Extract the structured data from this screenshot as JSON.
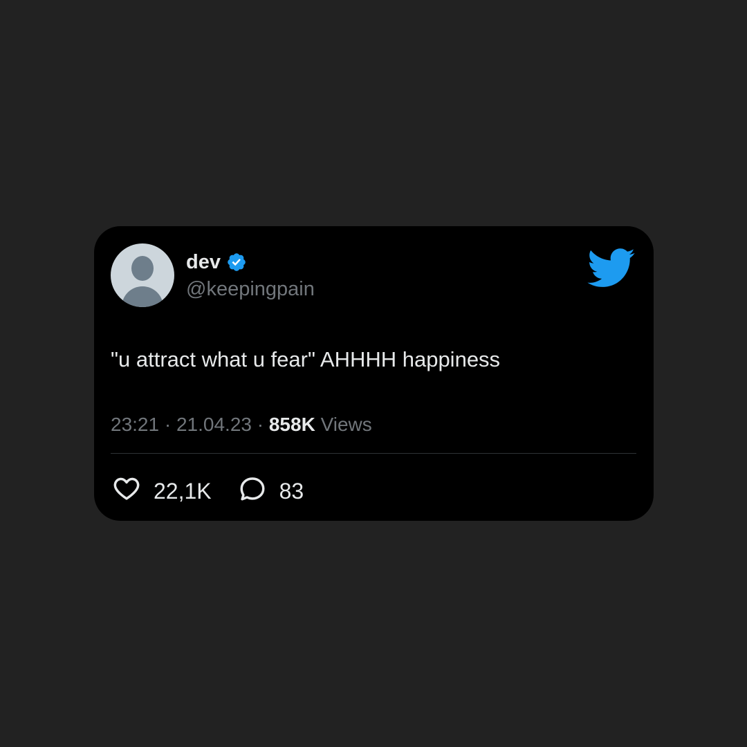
{
  "user": {
    "display_name": "dev",
    "handle": "@keepingpain",
    "verified": true
  },
  "tweet": {
    "text": "\"u attract what u fear\" AHHHH happiness",
    "time": "23:21",
    "date": "21.04.23",
    "views_count": "858K",
    "views_label": "Views",
    "separator": " · "
  },
  "actions": {
    "likes": "22,1K",
    "replies": "83"
  },
  "icons": {
    "avatar": "default-avatar-icon",
    "verified": "verified-badge-icon",
    "brand": "twitter-bird-icon",
    "like": "heart-icon",
    "reply": "speech-bubble-icon"
  },
  "colors": {
    "background": "#222222",
    "card": "#000000",
    "accent": "#1d9bf0",
    "text_primary": "#e7e9ea",
    "text_secondary": "#71767b",
    "avatar_bg": "#cdd6dc",
    "avatar_fg": "#6e7e8b"
  }
}
